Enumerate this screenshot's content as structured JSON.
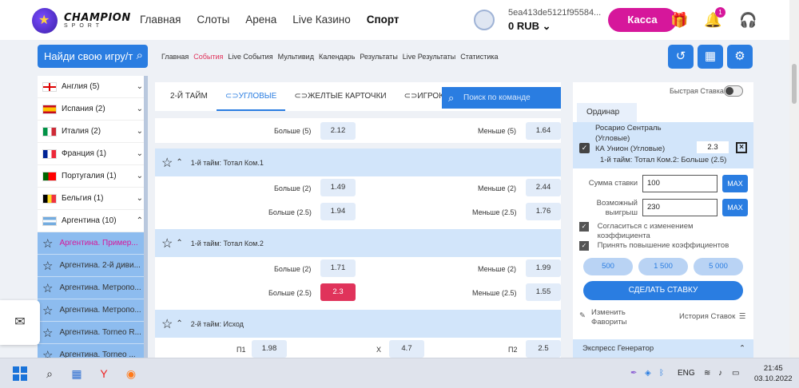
{
  "header": {
    "logo_line1": "CHAMPION",
    "logo_line2": "SPORT",
    "nav": [
      "Главная",
      "Слоты",
      "Арена",
      "Live Казино",
      "Спорт"
    ],
    "account_id": "5ea413de5121f95584...",
    "balance": "0 RUB",
    "cashier_label": "Касса",
    "notification_count": "1"
  },
  "search": {
    "placeholder": "Найди свою игру/т"
  },
  "subnav": [
    "Главная",
    "События",
    "Live События",
    "Мультивид",
    "Календарь",
    "Результаты",
    "Live Результаты",
    "Статистика"
  ],
  "countries": [
    {
      "name": "Англия (5)",
      "flag": "england"
    },
    {
      "name": "Испания (2)",
      "flag": "spain"
    },
    {
      "name": "Италия (2)",
      "flag": "italy"
    },
    {
      "name": "Франция (1)",
      "flag": "france"
    },
    {
      "name": "Португалия (1)",
      "flag": "portugal"
    },
    {
      "name": "Бельгия (1)",
      "flag": "belgium"
    },
    {
      "name": "Аргентина (10)",
      "flag": "argentina"
    }
  ],
  "leagues": [
    "Аргентина. Пример...",
    "Аргентина. 2-й диви...",
    "Аргентина. Метропо...",
    "Аргентина. Метропо...",
    "Аргентина. Torneo R...",
    "Аргентина. Torneo ..."
  ],
  "tabs": [
    "2-Й ТАЙМ",
    "УГЛОВЫЕ",
    "ЖЕЛТЫЕ КАРТОЧКИ",
    "ИГРОКИ"
  ],
  "team_search_placeholder": "Поиск по команде",
  "markets": {
    "top_row": {
      "l1": "Больше (5)",
      "o1": "2.12",
      "l2": "Меньше (5)",
      "o2": "1.64"
    },
    "m1": {
      "title": "1-й тайм: Тотал Ком.1",
      "rows": [
        {
          "l1": "Больше (2)",
          "o1": "1.49",
          "l2": "Меньше (2)",
          "o2": "2.44"
        },
        {
          "l1": "Больше (2.5)",
          "o1": "1.94",
          "l2": "Меньше (2.5)",
          "o2": "1.76"
        }
      ]
    },
    "m2": {
      "title": "1-й тайм: Тотал Ком.2",
      "rows": [
        {
          "l1": "Больше (2)",
          "o1": "1.71",
          "l2": "Меньше (2)",
          "o2": "1.99"
        },
        {
          "l1": "Больше (2.5)",
          "o1": "2.3",
          "l2": "Меньше (2.5)",
          "o2": "1.55"
        }
      ]
    },
    "m3": {
      "title": "2-й тайм: Исход",
      "row": {
        "l1": "П1",
        "o1": "1.98",
        "l2": "X",
        "o2": "4.7",
        "l3": "П2",
        "o3": "2.5"
      }
    }
  },
  "betslip": {
    "fast_bet": "Быстрая Ставка",
    "ordinar": "Ординар",
    "event_line1": "Росарио Сентраль",
    "event_line2": "(Угловые)",
    "event_line3": "КА Унион (Угловые)",
    "market": "1-й тайм: Тотал Ком.2: Больше (2.5)",
    "coef": "2.3",
    "stake_label": "Сумма ставки",
    "stake_value": "100",
    "win_label_1": "Возможный",
    "win_label_2": "выигрыш",
    "win_value": "230",
    "max_label": "MAX",
    "check1_line1": "Согласиться с изменением",
    "check1_line2": "коэффициента",
    "check2": "Принять повышение коэффициентов",
    "presets": [
      "500",
      "1 500",
      "5 000"
    ],
    "make_bet": "СДЕЛАТЬ СТАВКУ",
    "fav_line1": "Изменить",
    "fav_line2": "Фавориты",
    "history": "История Ставок",
    "express": "Экспресс Генератор"
  },
  "taskbar": {
    "lang": "ENG",
    "time": "21:45",
    "date": "03.10.2022"
  }
}
